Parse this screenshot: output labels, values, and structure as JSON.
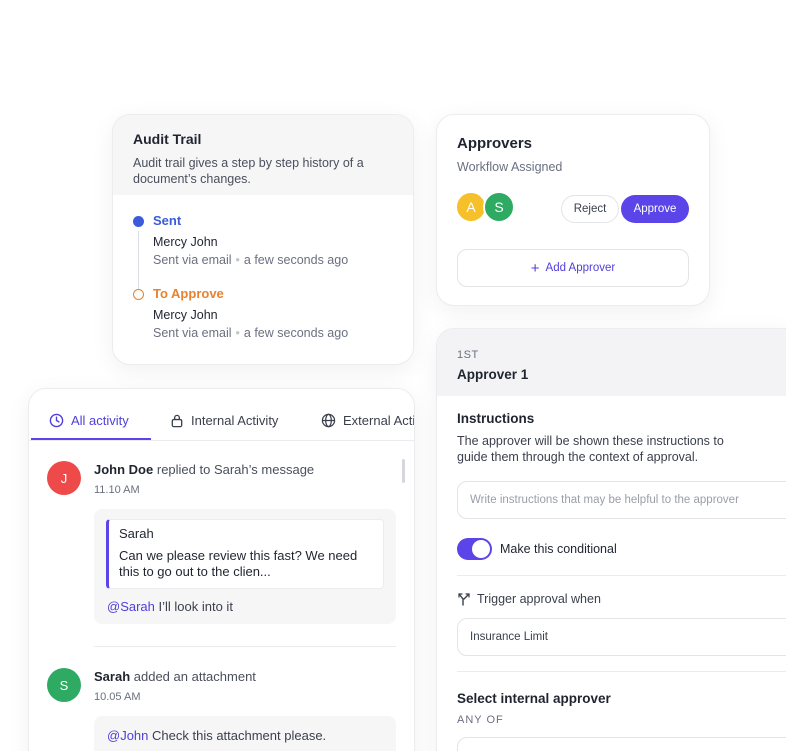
{
  "audit": {
    "title": "Audit Trail",
    "description": "Audit trail gives a step by step history of a document’s changes.",
    "items": [
      {
        "status": "Sent",
        "status_color": "#3b5bdb",
        "name": "Mercy John",
        "via": "Sent via email",
        "time": "a few seconds ago"
      },
      {
        "status": "To Approve",
        "status_color": "#e8822e",
        "name": "Mercy John",
        "via": "Sent via email",
        "time": "a few seconds ago"
      }
    ]
  },
  "approvers": {
    "title": "Approvers",
    "subtitle": "Workflow Assigned",
    "avatars": [
      {
        "initial": "A",
        "color": "#f5c02a"
      },
      {
        "initial": "S",
        "color": "#2eaa63"
      }
    ],
    "reject_label": "Reject",
    "approve_label": "Approve",
    "add_label": "Add Approver"
  },
  "activity": {
    "tabs": [
      {
        "label": "All activity",
        "icon": "clock-icon",
        "active": true
      },
      {
        "label": "Internal Activity",
        "icon": "lock-icon",
        "active": false
      },
      {
        "label": "External Acti",
        "icon": "globe-icon",
        "active": false
      }
    ],
    "entries": [
      {
        "initial": "J",
        "avatar_color": "#ef4a4a",
        "actor": "John Doe",
        "action": "replied to Sarah’s message",
        "time": "11.10 AM",
        "quote_name": "Sarah",
        "quote_text": "Can we please review this fast? We need this to go out to the clien...",
        "mention": "@Sarah",
        "reply": "I’ll look into it"
      },
      {
        "initial": "S",
        "avatar_color": "#2eaa63",
        "actor": "Sarah",
        "action": "added an attachment",
        "time": "10.05 AM",
        "mention": "@John",
        "reply": "Check this attachment please."
      }
    ]
  },
  "approver1": {
    "step": "1ST",
    "title": "Approver 1",
    "instructions_title": "Instructions",
    "instructions_desc": "The approver will be shown these instructions to guide them through the context of approval.",
    "instructions_placeholder": "Write instructions that may be helpful to the approver",
    "conditional_label": "Make this conditional",
    "conditional_on": true,
    "trigger_label": "Trigger approval when",
    "trigger_value": "Insurance Limit",
    "select_title": "Select internal approver",
    "any_of": "ANY OF"
  },
  "colors": {
    "accent": "#5b45e8"
  }
}
